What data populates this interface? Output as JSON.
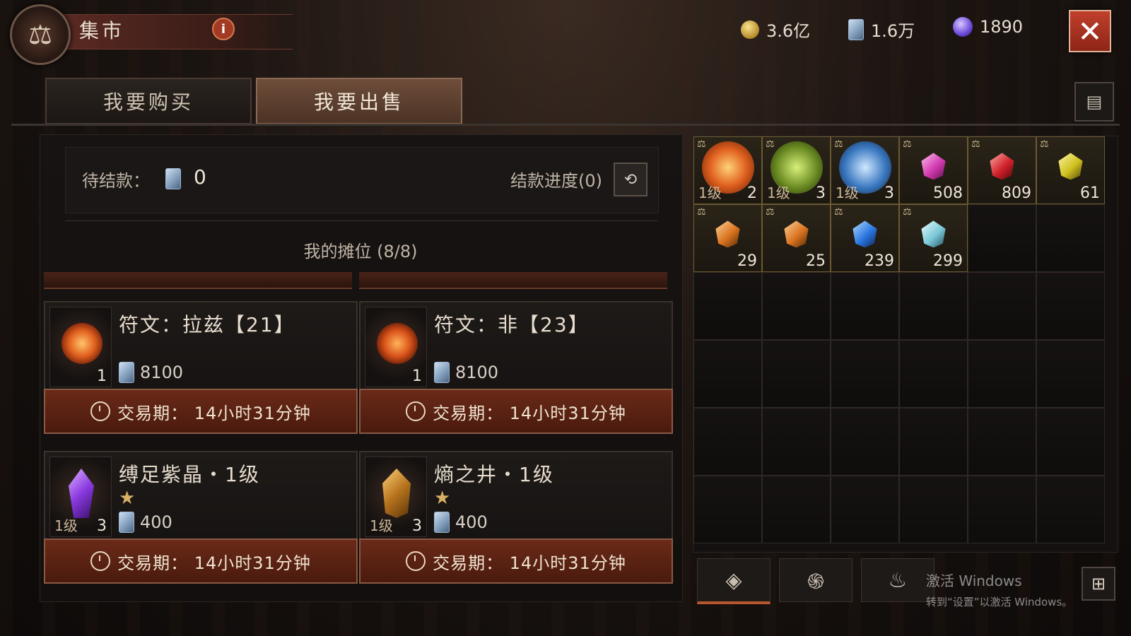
{
  "header": {
    "title": "集市",
    "info_label": "i",
    "close_label": "✕"
  },
  "currencies": [
    {
      "icon": "gold-coin-icon",
      "value": "3.6亿"
    },
    {
      "icon": "platinum-scroll-icon",
      "value": "1.6万"
    },
    {
      "icon": "eternal-orb-icon",
      "value": "1890"
    }
  ],
  "tabs": {
    "buy": "我要购买",
    "sell": "我要出售"
  },
  "pending": {
    "label": "待结款：",
    "value": "0",
    "progress_label": "结款进度(0)"
  },
  "stall": {
    "title": "我的摊位 (8/8)"
  },
  "listings": [
    {
      "name": "符文：拉兹【21】",
      "qty": "1",
      "price": "8100",
      "level": "",
      "star": "",
      "timer": "交易期：  14小时31分钟"
    },
    {
      "name": "符文：非【23】",
      "qty": "1",
      "price": "8100",
      "level": "",
      "star": "",
      "timer": "交易期：  14小时31分钟"
    },
    {
      "name": "缚足紫晶・1级",
      "qty": "3",
      "price": "400",
      "level": "1级",
      "star": "★",
      "timer": "交易期：  14小时31分钟"
    },
    {
      "name": "熵之井・1级",
      "qty": "3",
      "price": "400",
      "level": "1级",
      "star": "★",
      "timer": "交易期：  14小时31分钟"
    }
  ],
  "inventory": [
    {
      "kind": "fire-gem-icon",
      "level": "1级",
      "qty": "2"
    },
    {
      "kind": "green-gem-icon",
      "level": "1级",
      "qty": "3"
    },
    {
      "kind": "frost-gem-icon",
      "level": "1级",
      "qty": "3"
    },
    {
      "kind": "pink-gem-icon",
      "level": "",
      "qty": "508"
    },
    {
      "kind": "ruby-icon",
      "level": "",
      "qty": "809"
    },
    {
      "kind": "topaz-icon",
      "level": "",
      "qty": "61"
    },
    {
      "kind": "amber-gem-icon",
      "level": "",
      "qty": "29"
    },
    {
      "kind": "amber-gem-icon",
      "level": "",
      "qty": "25"
    },
    {
      "kind": "sapphire-icon",
      "level": "",
      "qty": "239"
    },
    {
      "kind": "diamond-icon",
      "level": "",
      "qty": "299"
    }
  ],
  "watermark": {
    "line1": "激活 Windows",
    "line2": "转到“设置”以激活 Windows。"
  },
  "colors": {
    "accent": "#b8562e",
    "timer_bg": "#6a2a18",
    "gold": "#d8b064"
  }
}
